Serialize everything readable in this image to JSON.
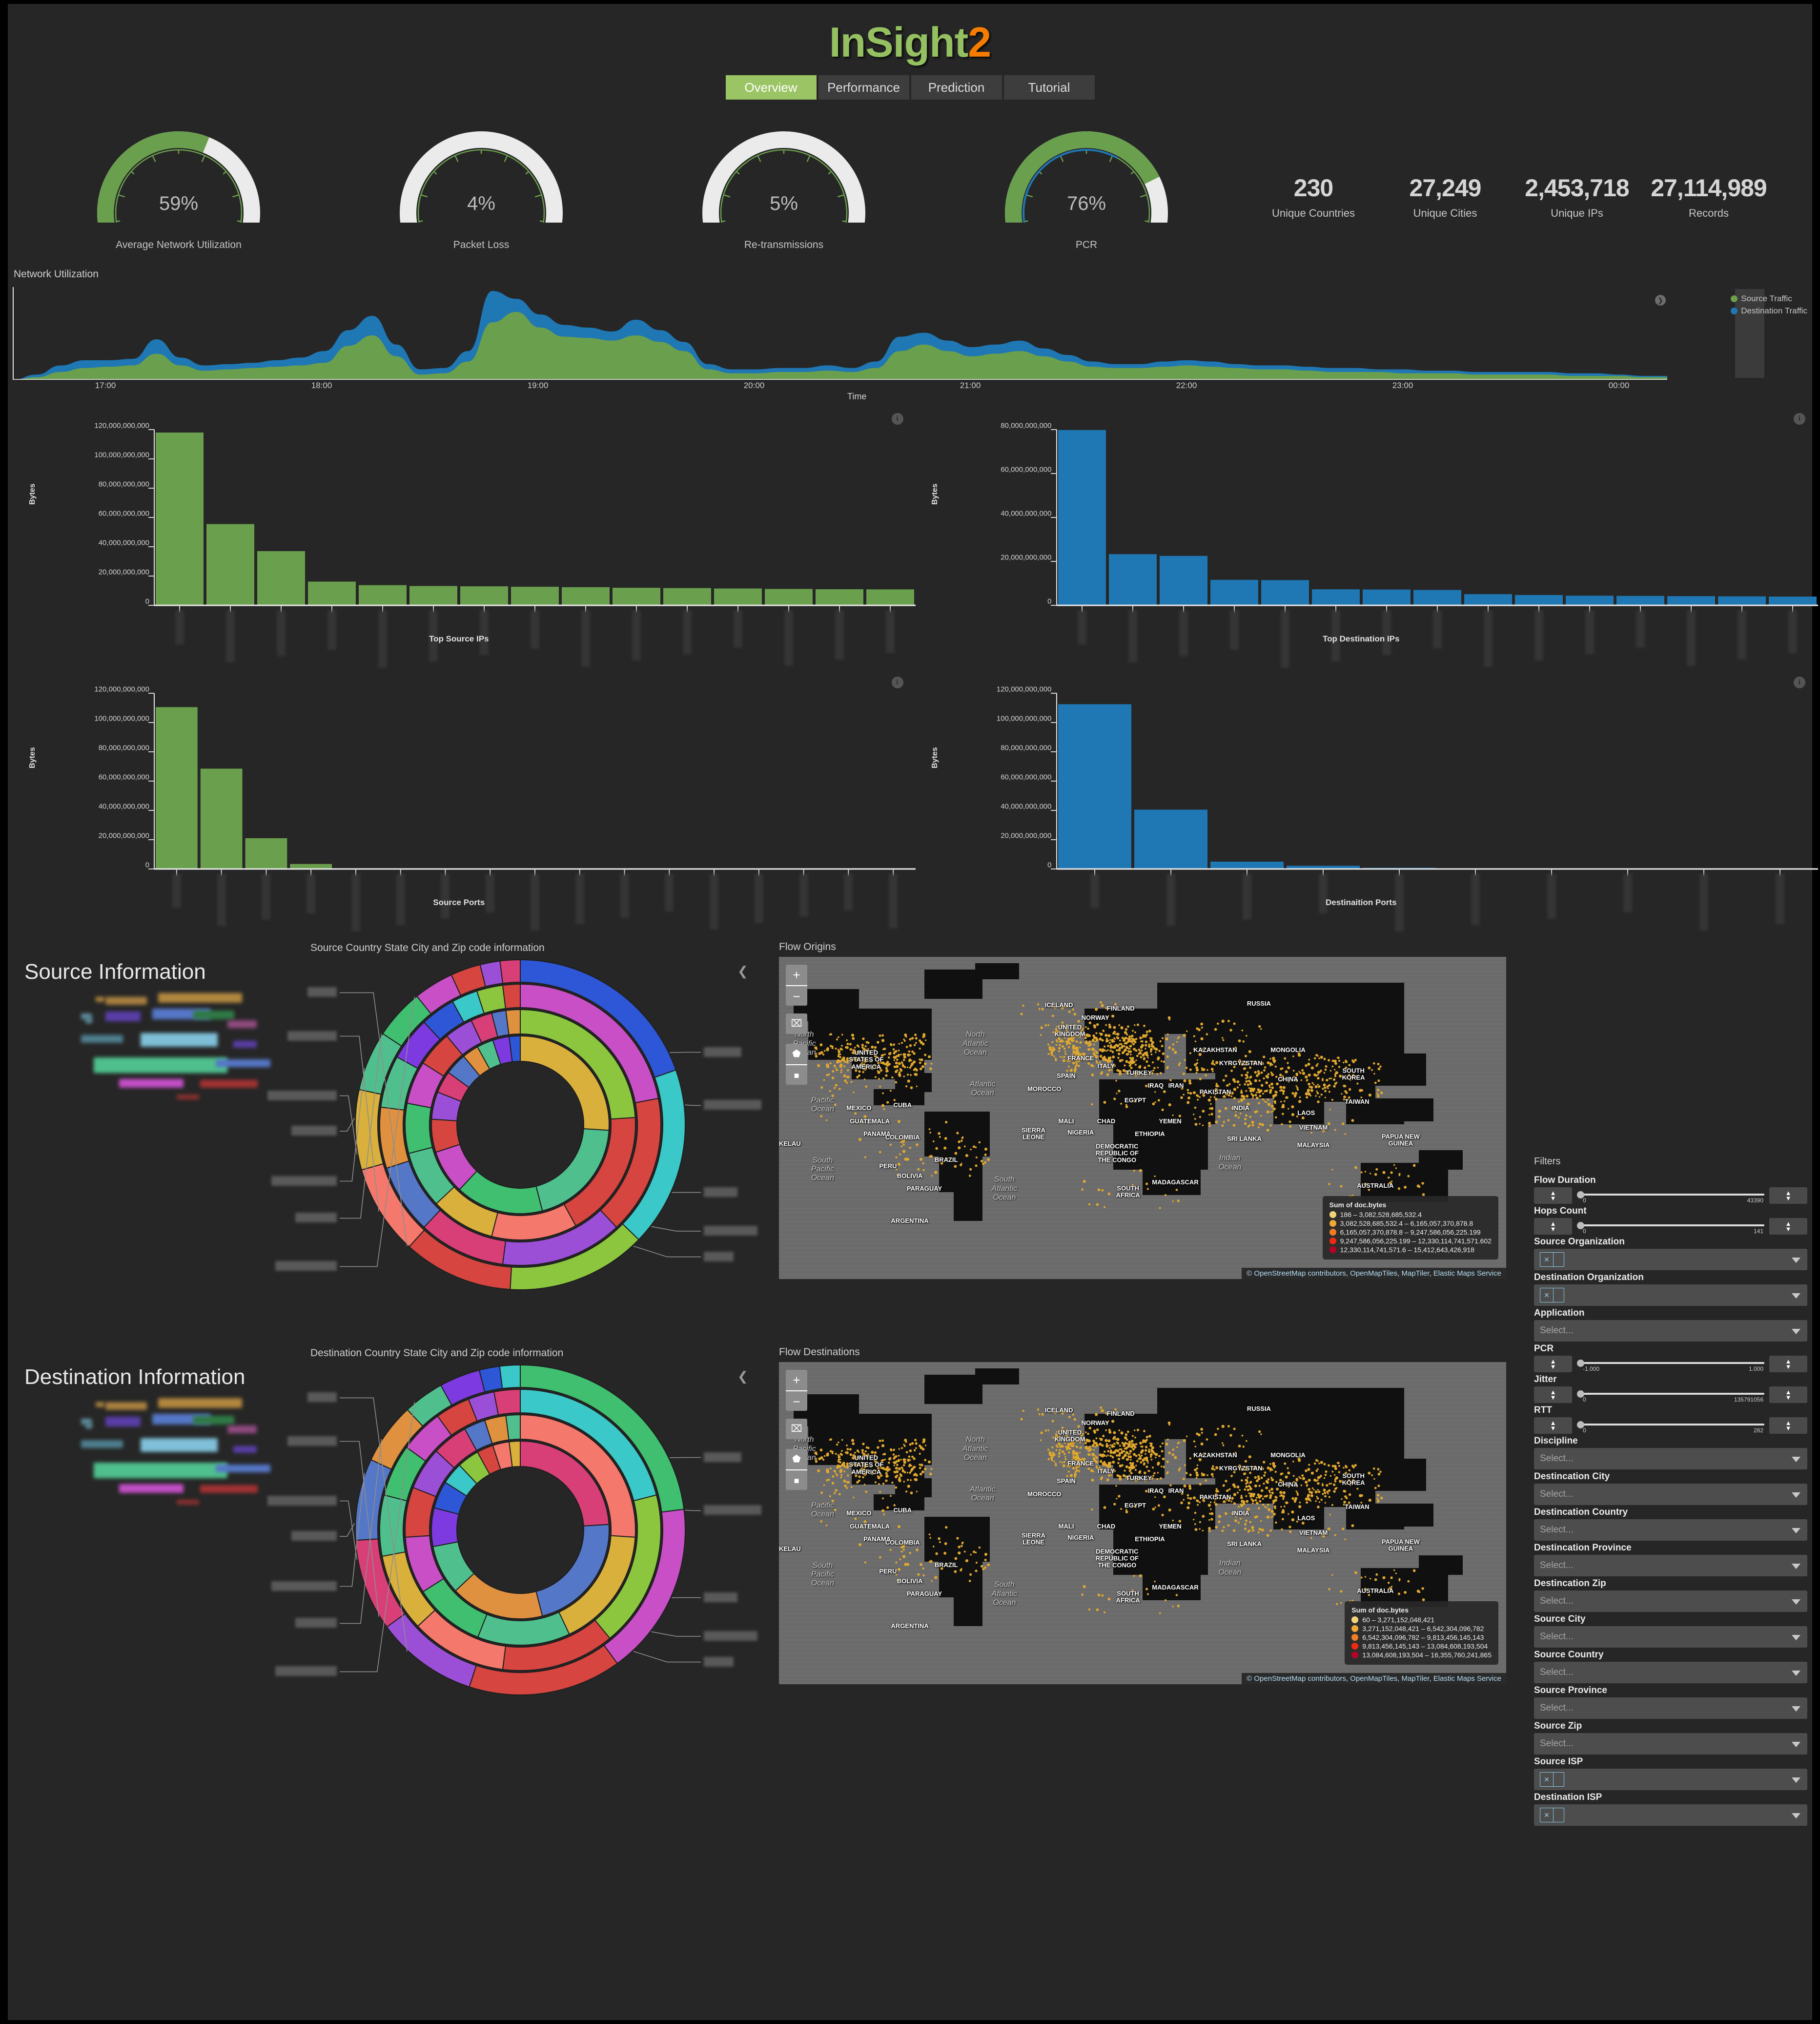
{
  "app": {
    "logo_part1": "InSight",
    "logo_part2": "2",
    "colors": {
      "green": "#6a9f4d",
      "blue": "#1f77b4",
      "accent_green": "#9bc464",
      "accent_orange": "#f57c00"
    }
  },
  "tabs": [
    {
      "label": "Overview",
      "active": true
    },
    {
      "label": "Performance",
      "active": false
    },
    {
      "label": "Prediction",
      "active": false
    },
    {
      "label": "Tutorial",
      "active": false
    }
  ],
  "gauges": [
    {
      "value": "59%",
      "pct": 59,
      "label": "Average Network Utilization",
      "secondary": null
    },
    {
      "value": "4%",
      "pct": 4,
      "label": "Packet Loss",
      "secondary": null
    },
    {
      "value": "5%",
      "pct": 5,
      "label": "Re-transmissions",
      "secondary": null
    },
    {
      "value": "76%",
      "pct": 76,
      "label": "PCR",
      "secondary": 62
    }
  ],
  "stats": [
    {
      "value": "230",
      "label": "Unique Countries"
    },
    {
      "value": "27,249",
      "label": "Unique Cities"
    },
    {
      "value": "2,453,718",
      "label": "Unique IPs"
    },
    {
      "value": "27,114,989",
      "label": "Records"
    }
  ],
  "network_utilization": {
    "title": "Network Utilization",
    "xlabel": "Time",
    "legend": [
      {
        "label": "Source Traffic",
        "color": "#6a9f4d"
      },
      {
        "label": "Destination Traffic",
        "color": "#1f77b4"
      }
    ],
    "ticks": [
      "17:00",
      "18:00",
      "19:00",
      "20:00",
      "21:00",
      "22:00",
      "23:00",
      "00:00"
    ]
  },
  "chart_data": [
    {
      "type": "area",
      "title": "Network Utilization",
      "xlabel": "Time",
      "ylabel": "",
      "tick_labels": [
        "17:00",
        "18:00",
        "19:00",
        "20:00",
        "21:00",
        "22:00",
        "23:00",
        "00:00"
      ],
      "legend_position": "right",
      "series": [
        {
          "name": "Source Traffic",
          "color": "#6a9f4d",
          "values": [
            0,
            2,
            6,
            9,
            10,
            11,
            20,
            11,
            7,
            8,
            9,
            10,
            11,
            13,
            26,
            34,
            18,
            4,
            5,
            14,
            44,
            52,
            40,
            33,
            32,
            30,
            34,
            29,
            22,
            8,
            5,
            5,
            6,
            6,
            7,
            6,
            9,
            22,
            27,
            22,
            18,
            20,
            22,
            18,
            14,
            10,
            9,
            9,
            10,
            11,
            10,
            9,
            8,
            8,
            7,
            6,
            6,
            6,
            5,
            5,
            5,
            4,
            4,
            4,
            4,
            3,
            3,
            3,
            2,
            2
          ]
        },
        {
          "name": "Destination Traffic",
          "color": "#1f77b4",
          "values": [
            0,
            4,
            11,
            15,
            15,
            16,
            31,
            17,
            11,
            12,
            13,
            15,
            17,
            22,
            38,
            49,
            27,
            8,
            9,
            22,
            68,
            62,
            50,
            42,
            40,
            37,
            46,
            38,
            29,
            12,
            8,
            8,
            9,
            9,
            11,
            9,
            14,
            33,
            36,
            30,
            25,
            27,
            30,
            24,
            19,
            14,
            12,
            12,
            14,
            15,
            14,
            12,
            11,
            11,
            10,
            9,
            9,
            8,
            8,
            7,
            7,
            6,
            6,
            6,
            6,
            5,
            5,
            4,
            3,
            3
          ]
        }
      ]
    },
    {
      "type": "bar",
      "title": "Top Source IPs",
      "xlabel": "Top Source IPs",
      "ylabel": "Bytes",
      "color": "#6a9f4d",
      "ylim": [
        0,
        120000000000
      ],
      "ytick_labels": [
        "0",
        "20,000,000,000",
        "40,000,000,000",
        "60,000,000,000",
        "80,000,000,000",
        "100,000,000,000",
        "120,000,000,000"
      ],
      "categories": [
        "",
        "",
        "",
        "",
        "",
        "",
        "",
        "",
        "",
        "",
        "",
        "",
        "",
        "",
        ""
      ],
      "values": [
        118000000000,
        55500000000,
        37000000000,
        16200000000,
        13800000000,
        13200000000,
        13000000000,
        12700000000,
        12400000000,
        12000000000,
        11800000000,
        11500000000,
        11200000000,
        11000000000,
        10900000000
      ]
    },
    {
      "type": "bar",
      "title": "Top Destination IPs",
      "xlabel": "Top Destination IPs",
      "ylabel": "Bytes",
      "color": "#1f77b4",
      "ylim": [
        0,
        80000000000
      ],
      "ytick_labels": [
        "0",
        "20,000,000,000",
        "40,000,000,000",
        "60,000,000,000",
        "80,000,000,000"
      ],
      "categories": [
        "",
        "",
        "",
        "",
        "",
        "",
        "",
        "",
        "",
        "",
        "",
        "",
        "",
        "",
        ""
      ],
      "values": [
        79800000000,
        23300000000,
        22500000000,
        11600000000,
        11500000000,
        7300000000,
        7200000000,
        7000000000,
        5100000000,
        4700000000,
        4400000000,
        4300000000,
        4200000000,
        4100000000,
        4000000000
      ]
    },
    {
      "type": "bar",
      "title": "Source Ports",
      "xlabel": "Source Ports",
      "ylabel": "Bytes",
      "color": "#6a9f4d",
      "ylim": [
        0,
        120000000000
      ],
      "ytick_labels": [
        "0",
        "20,000,000,000",
        "40,000,000,000",
        "60,000,000,000",
        "80,000,000,000",
        "100,000,000,000",
        "120,000,000,000"
      ],
      "categories": [
        "",
        "",
        "",
        "",
        "",
        "",
        "",
        "",
        "",
        "",
        "",
        "",
        "",
        "",
        "",
        "",
        ""
      ],
      "values": [
        110500000000,
        68500000000,
        21000000000,
        3400000000,
        400000000,
        300000000,
        250000000,
        200000000,
        180000000,
        150000000,
        130000000,
        110000000,
        100000000,
        90000000,
        80000000,
        70000000,
        60000000
      ]
    },
    {
      "type": "bar",
      "title": "Destinaition Ports",
      "xlabel": "Destinaition Ports",
      "ylabel": "Bytes",
      "color": "#1f77b4",
      "ylim": [
        0,
        120000000000
      ],
      "ytick_labels": [
        "0",
        "20,000,000,000",
        "40,000,000,000",
        "60,000,000,000",
        "80,000,000,000",
        "100,000,000,000",
        "120,000,000,000"
      ],
      "categories": [
        "",
        "",
        "",
        "",
        "",
        "",
        "",
        "",
        "",
        ""
      ],
      "values": [
        112500000000,
        40500000000,
        5000000000,
        2200000000,
        800000000,
        400000000,
        300000000,
        250000000,
        150000000,
        100000000
      ]
    }
  ],
  "source_section": {
    "heading": "Source Information",
    "sunburst_title": "Source Country State City and Zip code information",
    "map_title": "Flow Origins"
  },
  "destination_section": {
    "heading": "Destination Information",
    "sunburst_title": "Destination Country State City and Zip code information",
    "map_title": "Flow Destinations"
  },
  "map_controls": {
    "zoom_in": "+",
    "zoom_out": "−",
    "fit": "⌧",
    "draw_polygon": "⬟",
    "draw_rect": "■"
  },
  "map_attribution": "© OpenStreetMap contributors, OpenMapTiles, MapTiler, Elastic Maps Service",
  "origins_legend": {
    "title": "Sum of doc.bytes",
    "rows": [
      {
        "color": "#f2d37a",
        "text": "186 – 3,082,528,685,532.4"
      },
      {
        "color": "#f0a836",
        "text": "3,082,528,685,532.4 – 6,165,057,370,878.8"
      },
      {
        "color": "#ef7d24",
        "text": "6,165,057,370,878.8 – 9,247,586,056,225.199"
      },
      {
        "color": "#ef2a10",
        "text": "9,247,586,056,225.199 – 12,330,114,741,571.602"
      },
      {
        "color": "#b50425",
        "text": "12,330,114,741,571.6 – 15,412,643,426,918"
      }
    ]
  },
  "destinations_legend": {
    "title": "Sum of doc.bytes",
    "rows": [
      {
        "color": "#f2d37a",
        "text": "60 – 3,271,152,048,421"
      },
      {
        "color": "#f0a836",
        "text": "3,271,152,048,421 – 6,542,304,096,782"
      },
      {
        "color": "#ef7d24",
        "text": "6,542,304,096,782 – 9,813,456,145,143"
      },
      {
        "color": "#ef2a10",
        "text": "9,813,456,145,143 – 13,084,608,193,504"
      },
      {
        "color": "#b50425",
        "text": "13,084,608,193,504 – 16,355,760,241,865"
      }
    ]
  },
  "map_country_labels": [
    "ICELAND",
    "FINLAND",
    "NORWAY",
    "RUSSIA",
    "UNITED\nKINGDOM",
    "KAZAKHSTAN",
    "MONGOLIA",
    "FRANCE",
    "ITALY",
    "KYRGYZSTAN",
    "CHINA",
    "SOUTH\nKOREA",
    "SPAIN",
    "TURKEY",
    "IRAQ",
    "IRAN",
    "PAKISTAN",
    "TAIWAN",
    "MOROCCO",
    "EGYPT",
    "INDIA",
    "LAOS",
    "MALI",
    "CHAD",
    "YEMEN",
    "VIETNAM",
    "SIERRA\nLEONE",
    "NIGERIA",
    "ETHIOPIA",
    "SRI LANKA",
    "MALAYSIA",
    "DEMOCRATIC\nREPUBLIC OF\nTHE CONGO",
    "PAPUA NEW\nGUINEA",
    "MADAGASCAR",
    "SOUTH\nAFRICA",
    "AUSTRALIA",
    "UNITED\nSTATES OF\nAMERICA",
    "MEXICO",
    "CUBA",
    "GUATEMALA",
    "PANAMA",
    "COLOMBIA",
    "PERU",
    "BRAZIL",
    "BOLIVIA",
    "PARAGUAY",
    "ARGENTINA",
    "KELAU"
  ],
  "map_ocean_labels": [
    "North\nPacific\nOcean",
    "North\nAtlantic\nOcean",
    "Atlantic\nOcean",
    "Pacific\nOcean",
    "Indian\nOcean",
    "South\nPacific\nOcean",
    "South\nAtlantic\nOcean"
  ],
  "filters": {
    "title": "Filters",
    "items": [
      {
        "label": "Flow Duration",
        "kind": "range",
        "min": "0",
        "max": "43390"
      },
      {
        "label": "Hops Count",
        "kind": "range",
        "min": "0",
        "max": "141"
      },
      {
        "label": "Source Organization",
        "kind": "chip"
      },
      {
        "label": "Destination Organization",
        "kind": "chip"
      },
      {
        "label": "Application",
        "kind": "select",
        "placeholder": "Select..."
      },
      {
        "label": "PCR",
        "kind": "range",
        "min": "-1.000",
        "max": "1.000"
      },
      {
        "label": "Jitter",
        "kind": "range",
        "min": "0",
        "max": "135791056"
      },
      {
        "label": "RTT",
        "kind": "range",
        "min": "0",
        "max": "282"
      },
      {
        "label": "Discipline",
        "kind": "select",
        "placeholder": "Select..."
      },
      {
        "label": "Destincation City",
        "kind": "select",
        "placeholder": "Select..."
      },
      {
        "label": "Destincation Country",
        "kind": "select",
        "placeholder": "Select..."
      },
      {
        "label": "Destincation Province",
        "kind": "select",
        "placeholder": "Select..."
      },
      {
        "label": "Destincation Zip",
        "kind": "select",
        "placeholder": "Select..."
      },
      {
        "label": "Source City",
        "kind": "select",
        "placeholder": "Select..."
      },
      {
        "label": "Source Country",
        "kind": "select",
        "placeholder": "Select..."
      },
      {
        "label": "Source Province",
        "kind": "select",
        "placeholder": "Select..."
      },
      {
        "label": "Source Zip",
        "kind": "select",
        "placeholder": "Select..."
      },
      {
        "label": "Source ISP",
        "kind": "chip"
      },
      {
        "label": "Destination ISP",
        "kind": "chip"
      }
    ]
  }
}
